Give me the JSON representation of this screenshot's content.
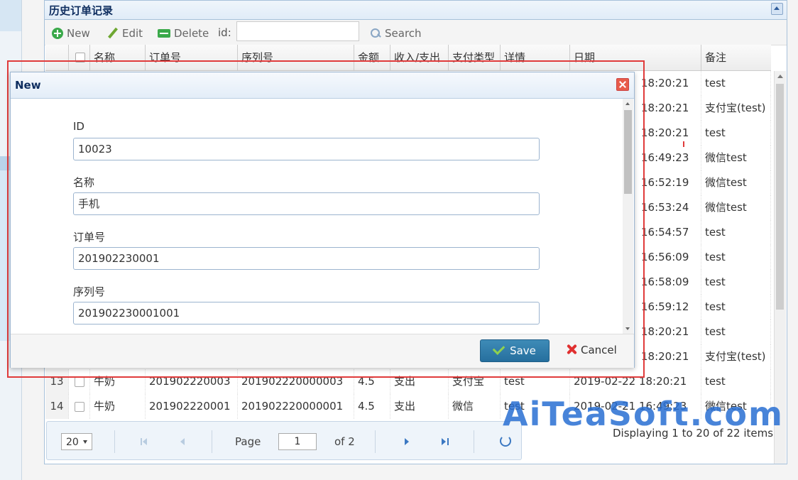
{
  "panel": {
    "title": "历史订单记录"
  },
  "toolbar": {
    "new_label": "New",
    "edit_label": "Edit",
    "delete_label": "Delete",
    "id_label": "id:",
    "id_value": "",
    "search_label": "Search"
  },
  "grid": {
    "columns": [
      "名称",
      "订单号",
      "序列号",
      "金额",
      "收入/支出",
      "支付类型",
      "详情",
      "日期",
      "备注"
    ],
    "rows": [
      {
        "time": "18:20:21",
        "note": "test"
      },
      {
        "time": "18:20:21",
        "note": "支付宝(test)"
      },
      {
        "time": "18:20:21",
        "note": "test"
      },
      {
        "time": "16:49:23",
        "note": "微信test"
      },
      {
        "time": "16:52:19",
        "note": "微信test"
      },
      {
        "time": "16:53:24",
        "note": "微信test"
      },
      {
        "time": "16:54:57",
        "note": "test"
      },
      {
        "time": "16:56:09",
        "note": "test"
      },
      {
        "time": "16:58:09",
        "note": "test"
      },
      {
        "time": "16:59:12",
        "note": "test"
      },
      {
        "time": "18:20:21",
        "note": "test"
      },
      {
        "time": "18:20:21",
        "note": "支付宝(test)"
      },
      {
        "rn": "13",
        "name": "牛奶",
        "order": "201902220003",
        "serial": "201902220000003",
        "amount": "4.5",
        "io": "支出",
        "pay": "支付宝",
        "detail": "test",
        "date": "2019-02-22 18:20:21",
        "note": "test"
      },
      {
        "rn": "14",
        "name": "牛奶",
        "order": "201902220001",
        "serial": "201902220000001",
        "amount": "4.5",
        "io": "支出",
        "pay": "微信",
        "detail": "test",
        "date": "2019-02-21 16:49:23",
        "note": "微信test"
      }
    ]
  },
  "pager": {
    "page_size": "20",
    "page_label": "Page",
    "page_value": "1",
    "of_label": "of 2",
    "info": "Displaying 1 to 20 of 22 items"
  },
  "dialog": {
    "title": "New",
    "fields": [
      {
        "label": "ID",
        "value": "10023"
      },
      {
        "label": "名称",
        "value": "手机"
      },
      {
        "label": "订单号",
        "value": "201902230001"
      },
      {
        "label": "序列号",
        "value": "201902230001001"
      }
    ],
    "save_label": "Save",
    "cancel_label": "Cancel"
  },
  "watermark": "AiTeaSoft.com",
  "colors": {
    "accent": "#2a78ad",
    "highlight": "#e03b3b",
    "header_text": "#0e2d5f"
  }
}
